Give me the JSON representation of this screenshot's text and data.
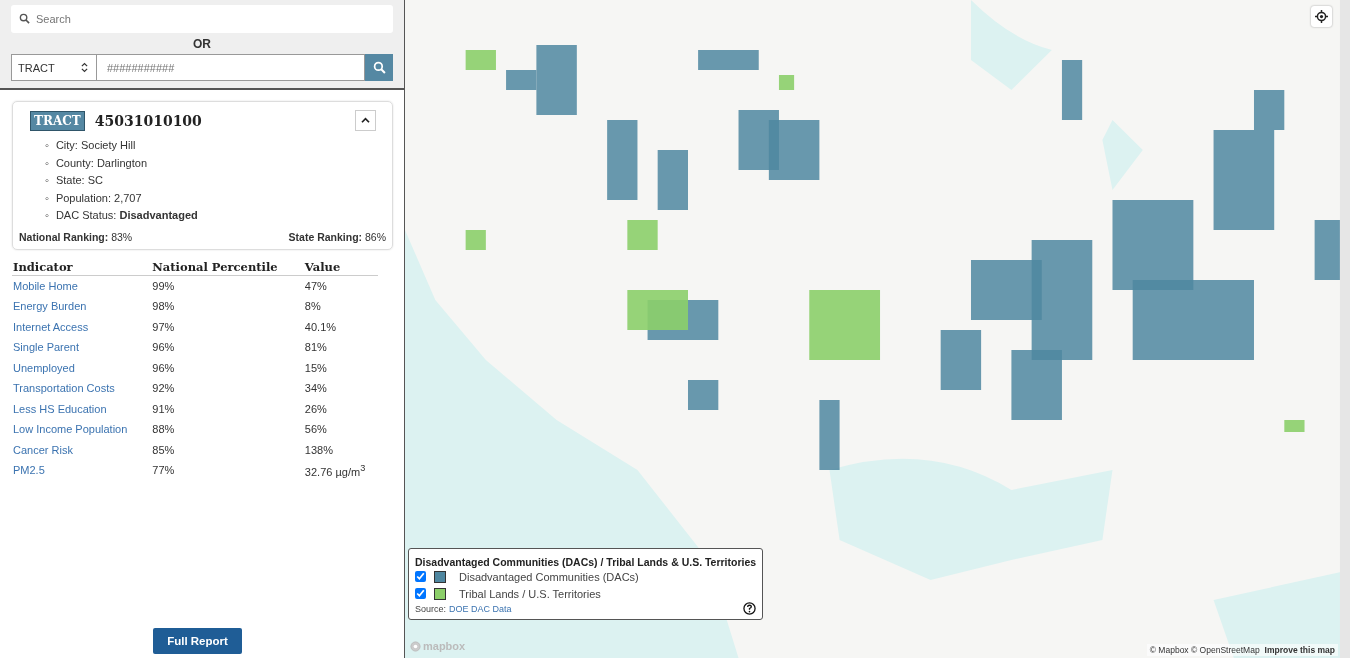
{
  "search": {
    "placeholder": "Search"
  },
  "or_label": "OR",
  "lookup": {
    "type_value": "TRACT",
    "placeholder": "###########"
  },
  "tract_card": {
    "badge": "TRACT",
    "id": "45031010100",
    "expanded": true,
    "details": [
      {
        "bullet": "◦",
        "label": "City:",
        "value": "Society Hill",
        "emphasis": false
      },
      {
        "bullet": "◦",
        "label": "County:",
        "value": "Darlington",
        "emphasis": false
      },
      {
        "bullet": "◦",
        "label": "State:",
        "value": "SC",
        "emphasis": false
      },
      {
        "bullet": "◦",
        "label": "Population:",
        "value": "2,707",
        "emphasis": false
      },
      {
        "bullet": "◦",
        "label": "DAC Status:",
        "value": "Disadvantaged",
        "emphasis": true
      }
    ],
    "national_ranking": {
      "label": "National Ranking:",
      "value": "83%"
    },
    "state_ranking": {
      "label": "State Ranking:",
      "value": "86%"
    }
  },
  "indicators": {
    "columns": [
      "Indicator",
      "National Percentile",
      "Value"
    ],
    "rows": [
      {
        "indicator": "Mobile Home",
        "percentile": "99%",
        "value": "47%"
      },
      {
        "indicator": "Energy Burden",
        "percentile": "98%",
        "value": "8%"
      },
      {
        "indicator": "Internet Access",
        "percentile": "97%",
        "value": "40.1%"
      },
      {
        "indicator": "Single Parent",
        "percentile": "96%",
        "value": "81%"
      },
      {
        "indicator": "Unemployed",
        "percentile": "96%",
        "value": "15%"
      },
      {
        "indicator": "Transportation Costs",
        "percentile": "92%",
        "value": "34%"
      },
      {
        "indicator": "Less HS Education",
        "percentile": "91%",
        "value": "26%"
      },
      {
        "indicator": "Low Income Population",
        "percentile": "88%",
        "value": "56%"
      },
      {
        "indicator": "Cancer Risk",
        "percentile": "85%",
        "value": "138%"
      },
      {
        "indicator": "PM2.5",
        "percentile": "77%",
        "value": "32.76 µg/m$^{3}$"
      }
    ]
  },
  "full_report_button": "Full Report",
  "legend": {
    "title": "Disadvantaged Communities (DACs) / Tribal Lands & U.S. Territories",
    "items": [
      {
        "label": "Disadvantaged Communities (DACs)",
        "checked": true,
        "color": "#4f87a0"
      },
      {
        "label": "Tribal Lands / U.S. Territories",
        "checked": true,
        "color": "#8ccf6a"
      }
    ],
    "source_label": "Source:",
    "source_link": "DOE DAC Data"
  },
  "attribution": {
    "logo": "mapbox",
    "text": "© Mapbox © OpenStreetMap",
    "improve_link": "Improve this map"
  }
}
